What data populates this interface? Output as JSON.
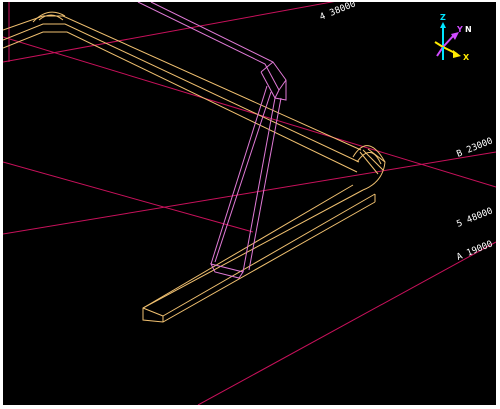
{
  "viewport": {
    "background": "#000000",
    "grid_color": "#c8115b",
    "pipe_color": "#f0c070",
    "support_color": "#e07ad6"
  },
  "grid_labels": {
    "label_4": "4 38000",
    "label_b": "B 23000",
    "label_5": "5 48000",
    "label_a": "A 19000"
  },
  "axis_indicator": {
    "z": "Z",
    "y": "Y",
    "n": "N",
    "x": "X",
    "colors": {
      "z": "#00e5ff",
      "y": "#d04bff",
      "n": "#ffffff",
      "x": "#ffea00"
    }
  }
}
